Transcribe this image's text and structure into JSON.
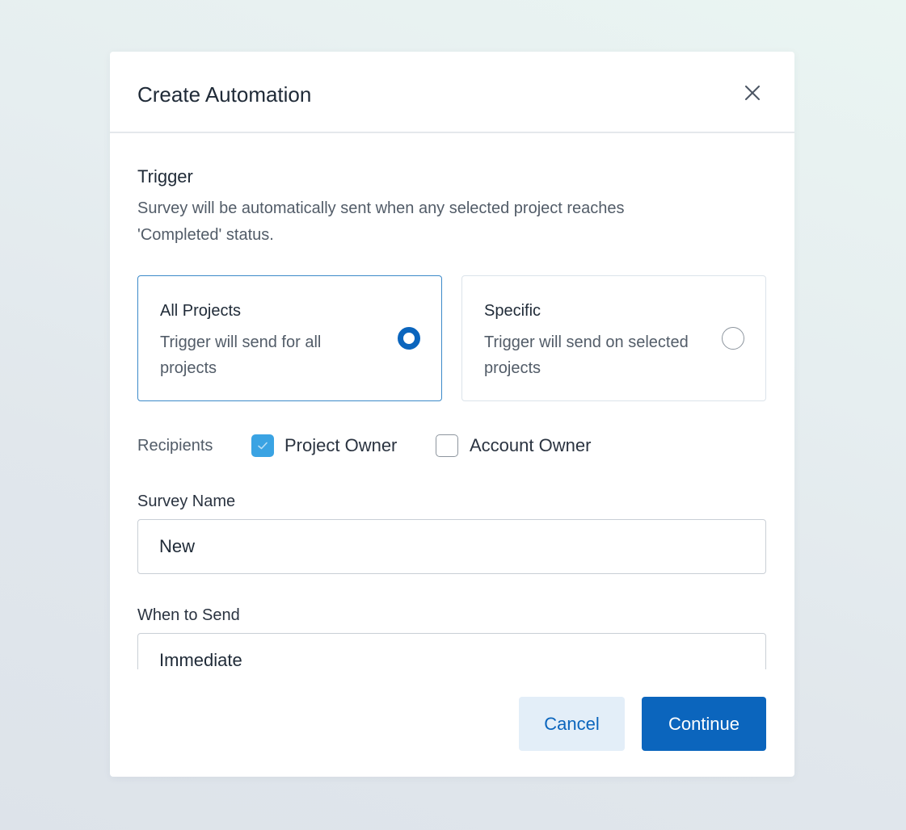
{
  "dialog": {
    "title": "Create Automation",
    "close_icon": "close-icon"
  },
  "trigger": {
    "title": "Trigger",
    "description": "Survey will be automatically sent when any selected project reaches 'Completed' status.",
    "options": [
      {
        "title": "All Projects",
        "description": "Trigger will send for all projects",
        "selected": true
      },
      {
        "title": "Specific",
        "description": "Trigger will send on selected projects",
        "selected": false
      }
    ]
  },
  "recipients": {
    "label": "Recipients",
    "options": [
      {
        "label": "Project Owner",
        "checked": true
      },
      {
        "label": "Account Owner",
        "checked": false
      }
    ]
  },
  "survey_name": {
    "label": "Survey Name",
    "value": "New"
  },
  "when_to_send": {
    "label": "When to Send",
    "value": "Immediate"
  },
  "actions": {
    "cancel_label": "Cancel",
    "continue_label": "Continue"
  },
  "colors": {
    "primary": "#0b65bd",
    "checkbox_checked": "#3aa3e3",
    "cancel_bg": "#e3eef8"
  }
}
